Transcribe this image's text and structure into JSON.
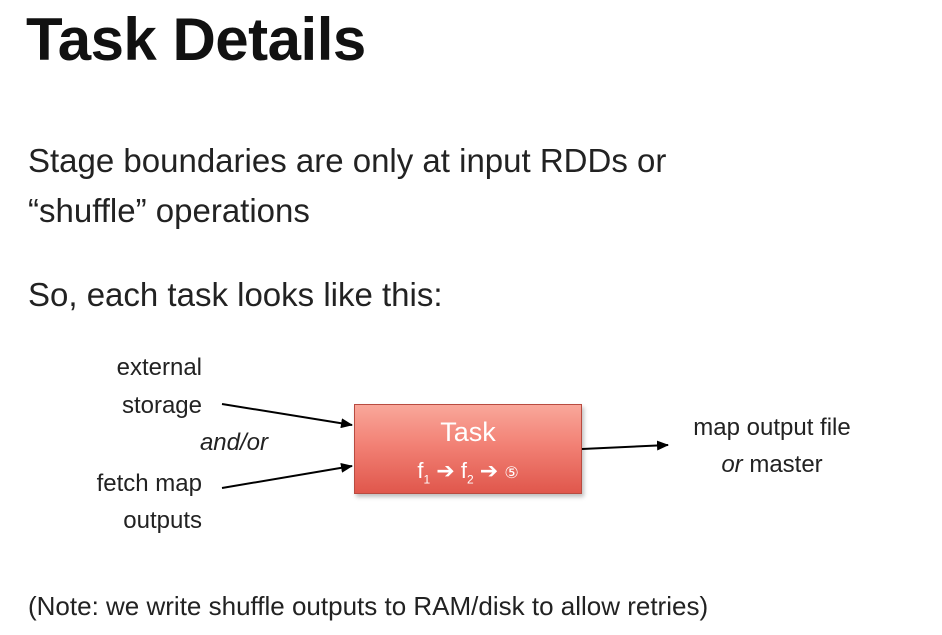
{
  "slide": {
    "title": "Task Details",
    "bullets": [
      "Stage boundaries are only at input RDDs or",
      "“shuffle” operations",
      "So, each task looks like this:"
    ],
    "note": "(Note: we write shuffle outputs to RAM/disk to allow retries)"
  },
  "diagram": {
    "inputs": {
      "external_line1": "external",
      "external_line2": "storage",
      "connector": "and/or",
      "fetch_line1": "fetch map",
      "fetch_line2": "outputs"
    },
    "task": {
      "title": "Task",
      "chain_f": "f",
      "chain_sub1": "1",
      "chain_arrow1": "➔",
      "chain_sub2": "2",
      "chain_arrow2": "➔",
      "chain_end": "⑤"
    },
    "output": {
      "line1": "map output file",
      "line2_or": "or",
      "line2_rest": " master"
    },
    "colors": {
      "task_fill": "#f28175",
      "task_border": "#b84b40",
      "arrow": "#000000"
    }
  }
}
